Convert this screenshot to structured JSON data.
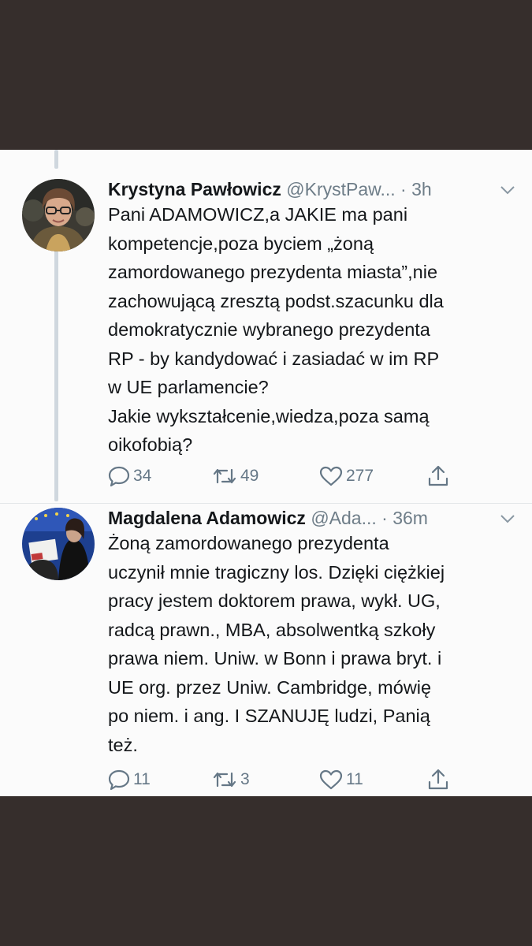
{
  "tweets": [
    {
      "name": "Krystyna Pawłowicz",
      "handle": "@KrystPaw...",
      "time": "· 3h",
      "text": "Pani ADAMOWICZ,a JAKIE ma pani\nkompetencje,poza byciem „żoną\nzamordowanego prezydenta miasta”,nie\nzachowującą zresztą podst.szacunku dla\ndemokratycznie wybranego prezydenta\nRP - by kandydować i zasiadać w im RP\nw UE parlamencie?\nJakie wykształcenie,wiedza,poza samą\noikofobią?",
      "replies": "34",
      "retweets": "49",
      "likes": "277",
      "avatar_icon": "woman-with-glasses-avatar"
    },
    {
      "name": "Magdalena Adamowicz",
      "handle": "@Ada...",
      "time": "· 36m",
      "text": "Żoną zamordowanego prezydenta\nuczynił mnie tragiczny los. Dzięki ciężkiej\npracy jestem doktorem prawa, wykł. UG,\nradcą prawn., MBA, absolwentką szkoły\nprawa niem. Uniw. w Bonn i prawa bryt. i\nUE org. przez Uniw. Cambridge, mówię\npo niem. i ang.  I SZANUJĘ ludzi, Panią\nteż.",
      "replies": "11",
      "retweets": "3",
      "likes": "11",
      "avatar_icon": "woman-holding-sign-avatar"
    }
  ],
  "colors": {
    "background_bars": "#362e2c",
    "panel": "#fbfbfb",
    "text": "#14171a",
    "secondary": "#657786",
    "thread_line": "#cfd7de"
  }
}
